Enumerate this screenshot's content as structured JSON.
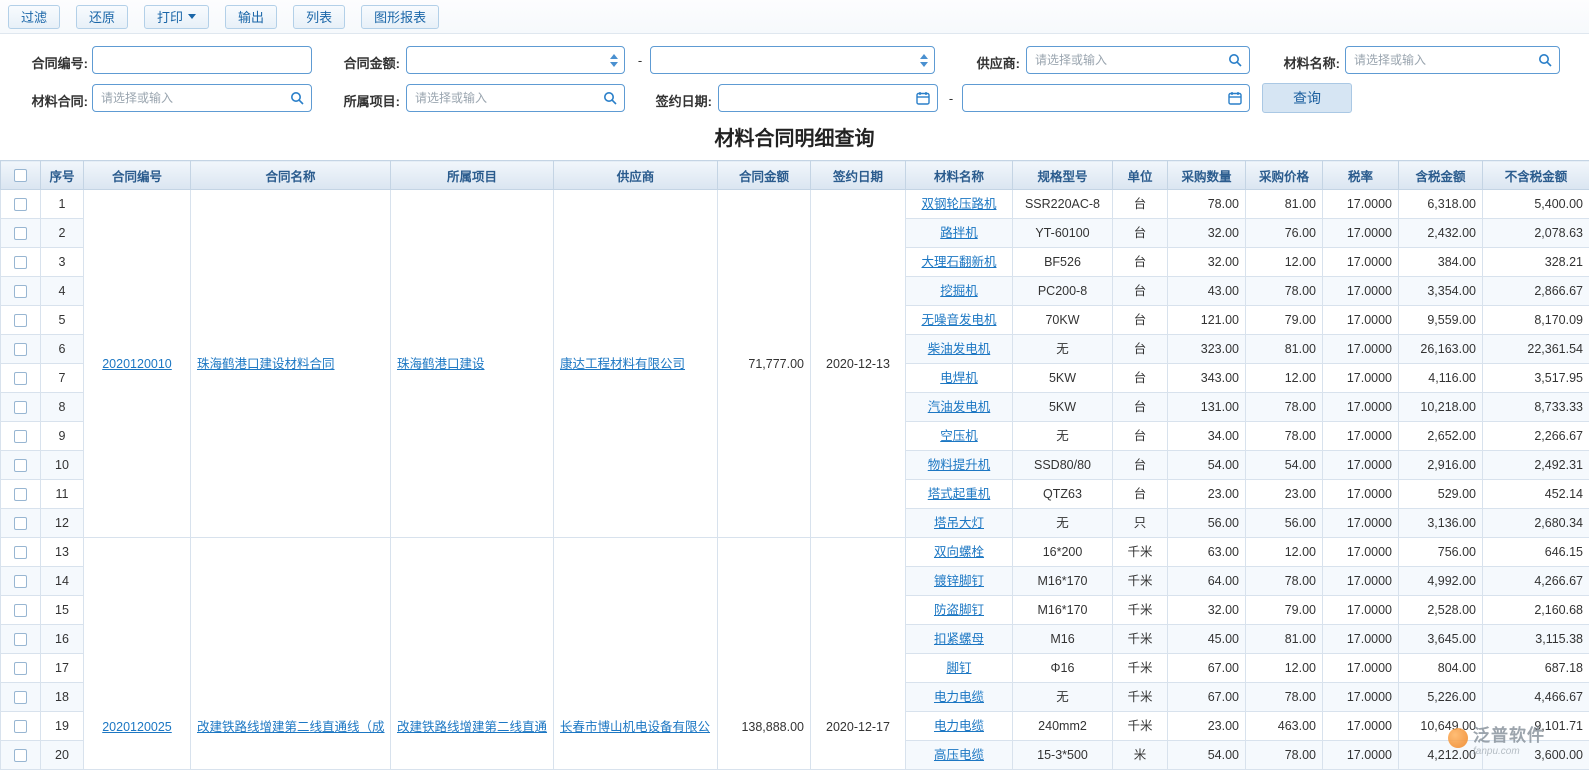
{
  "toolbar": {
    "buttons": [
      {
        "label": "过滤"
      },
      {
        "label": "还原"
      },
      {
        "label": "打印"
      },
      {
        "label": "输出"
      },
      {
        "label": "列表"
      },
      {
        "label": "图形报表"
      }
    ]
  },
  "filters": {
    "contract_no": {
      "label": "合同编号:"
    },
    "contract_amount": {
      "label": "合同金额:"
    },
    "supplier": {
      "label": "供应商:",
      "placeholder": "请选择或输入"
    },
    "material_name": {
      "label": "材料名称:",
      "placeholder": "请选择或输入"
    },
    "material_contract": {
      "label": "材料合同:",
      "placeholder": "请选择或输入"
    },
    "project": {
      "label": "所属项目:",
      "placeholder": "请选择或输入"
    },
    "sign_date": {
      "label": "签约日期:"
    },
    "range_separator": "-",
    "query_button": "查询"
  },
  "title": "材料合同明细查询",
  "table": {
    "headers": [
      "序号",
      "合同编号",
      "合同名称",
      "所属项目",
      "供应商",
      "合同金额",
      "签约日期",
      "材料名称",
      "规格型号",
      "单位",
      "采购数量",
      "采购价格",
      "税率",
      "含税金额",
      "不含税金额"
    ],
    "groups": [
      {
        "contract_no": "2020120010",
        "contract_name": "珠海鹤港口建设材料合同",
        "project": "珠海鹤港口建设",
        "supplier": "康达工程材料有限公司",
        "amount": "71,777.00",
        "sign_date": "2020-12-13",
        "rows": [
          {
            "no": 1,
            "material": "双钢轮压路机",
            "spec": "SSR220AC-8",
            "unit": "台",
            "qty": "78.00",
            "price": "81.00",
            "tax_rate": "17.0000",
            "tax_amount": "6,318.00",
            "no_tax_amount": "5,400.00"
          },
          {
            "no": 2,
            "material": "路拌机",
            "spec": "YT-60100",
            "unit": "台",
            "qty": "32.00",
            "price": "76.00",
            "tax_rate": "17.0000",
            "tax_amount": "2,432.00",
            "no_tax_amount": "2,078.63"
          },
          {
            "no": 3,
            "material": "大理石翻新机",
            "spec": "BF526",
            "unit": "台",
            "qty": "32.00",
            "price": "12.00",
            "tax_rate": "17.0000",
            "tax_amount": "384.00",
            "no_tax_amount": "328.21"
          },
          {
            "no": 4,
            "material": "挖掘机",
            "spec": "PC200-8",
            "unit": "台",
            "qty": "43.00",
            "price": "78.00",
            "tax_rate": "17.0000",
            "tax_amount": "3,354.00",
            "no_tax_amount": "2,866.67"
          },
          {
            "no": 5,
            "material": "无噪音发电机",
            "spec": "70KW",
            "unit": "台",
            "qty": "121.00",
            "price": "79.00",
            "tax_rate": "17.0000",
            "tax_amount": "9,559.00",
            "no_tax_amount": "8,170.09"
          },
          {
            "no": 6,
            "material": "柴油发电机",
            "spec": "无",
            "unit": "台",
            "qty": "323.00",
            "price": "81.00",
            "tax_rate": "17.0000",
            "tax_amount": "26,163.00",
            "no_tax_amount": "22,361.54"
          },
          {
            "no": 7,
            "material": "电焊机",
            "spec": "5KW",
            "unit": "台",
            "qty": "343.00",
            "price": "12.00",
            "tax_rate": "17.0000",
            "tax_amount": "4,116.00",
            "no_tax_amount": "3,517.95"
          },
          {
            "no": 8,
            "material": "汽油发电机",
            "spec": "5KW",
            "unit": "台",
            "qty": "131.00",
            "price": "78.00",
            "tax_rate": "17.0000",
            "tax_amount": "10,218.00",
            "no_tax_amount": "8,733.33"
          },
          {
            "no": 9,
            "material": "空压机",
            "spec": "无",
            "unit": "台",
            "qty": "34.00",
            "price": "78.00",
            "tax_rate": "17.0000",
            "tax_amount": "2,652.00",
            "no_tax_amount": "2,266.67"
          },
          {
            "no": 10,
            "material": "物料提升机",
            "spec": "SSD80/80",
            "unit": "台",
            "qty": "54.00",
            "price": "54.00",
            "tax_rate": "17.0000",
            "tax_amount": "2,916.00",
            "no_tax_amount": "2,492.31"
          },
          {
            "no": 11,
            "material": "塔式起重机",
            "spec": "QTZ63",
            "unit": "台",
            "qty": "23.00",
            "price": "23.00",
            "tax_rate": "17.0000",
            "tax_amount": "529.00",
            "no_tax_amount": "452.14"
          },
          {
            "no": 12,
            "material": "塔吊大灯",
            "spec": "无",
            "unit": "只",
            "qty": "56.00",
            "price": "56.00",
            "tax_rate": "17.0000",
            "tax_amount": "3,136.00",
            "no_tax_amount": "2,680.34"
          }
        ]
      },
      {
        "contract_no": "2020120025",
        "contract_name": "改建铁路线增建第二线直通线（成",
        "project": "改建铁路线增建第二线直通",
        "supplier": "长春市博山机电设备有限公",
        "amount": "138,888.00",
        "sign_date": "2020-12-17",
        "rows": [
          {
            "no": 13,
            "material": "双向螺栓",
            "spec": "16*200",
            "unit": "千米",
            "qty": "63.00",
            "price": "12.00",
            "tax_rate": "17.0000",
            "tax_amount": "756.00",
            "no_tax_amount": "646.15"
          },
          {
            "no": 14,
            "material": "镀锌脚钉",
            "spec": "M16*170",
            "unit": "千米",
            "qty": "64.00",
            "price": "78.00",
            "tax_rate": "17.0000",
            "tax_amount": "4,992.00",
            "no_tax_amount": "4,266.67"
          },
          {
            "no": 15,
            "material": "防盗脚钉",
            "spec": "M16*170",
            "unit": "千米",
            "qty": "32.00",
            "price": "79.00",
            "tax_rate": "17.0000",
            "tax_amount": "2,528.00",
            "no_tax_amount": "2,160.68"
          },
          {
            "no": 16,
            "material": "扣紧螺母",
            "spec": "M16",
            "unit": "千米",
            "qty": "45.00",
            "price": "81.00",
            "tax_rate": "17.0000",
            "tax_amount": "3,645.00",
            "no_tax_amount": "3,115.38"
          },
          {
            "no": 17,
            "material": "脚钉",
            "spec": "Φ16",
            "unit": "千米",
            "qty": "67.00",
            "price": "12.00",
            "tax_rate": "17.0000",
            "tax_amount": "804.00",
            "no_tax_amount": "687.18"
          },
          {
            "no": 18,
            "material": "电力电缆",
            "spec": "无",
            "unit": "千米",
            "qty": "67.00",
            "price": "78.00",
            "tax_rate": "17.0000",
            "tax_amount": "5,226.00",
            "no_tax_amount": "4,466.67"
          },
          {
            "no": 19,
            "material": "电力电缆",
            "spec": "240mm2",
            "unit": "千米",
            "qty": "23.00",
            "price": "463.00",
            "tax_rate": "17.0000",
            "tax_amount": "10,649.00",
            "no_tax_amount": "9,101.71"
          },
          {
            "no": 20,
            "material": "高压电缆",
            "spec": "15-3*500",
            "unit": "米",
            "qty": "54.00",
            "price": "78.00",
            "tax_rate": "17.0000",
            "tax_amount": "4,212.00",
            "no_tax_amount": "3,600.00"
          }
        ]
      }
    ]
  },
  "watermark": {
    "brand": "泛普软件",
    "site": "fanpu.com"
  }
}
